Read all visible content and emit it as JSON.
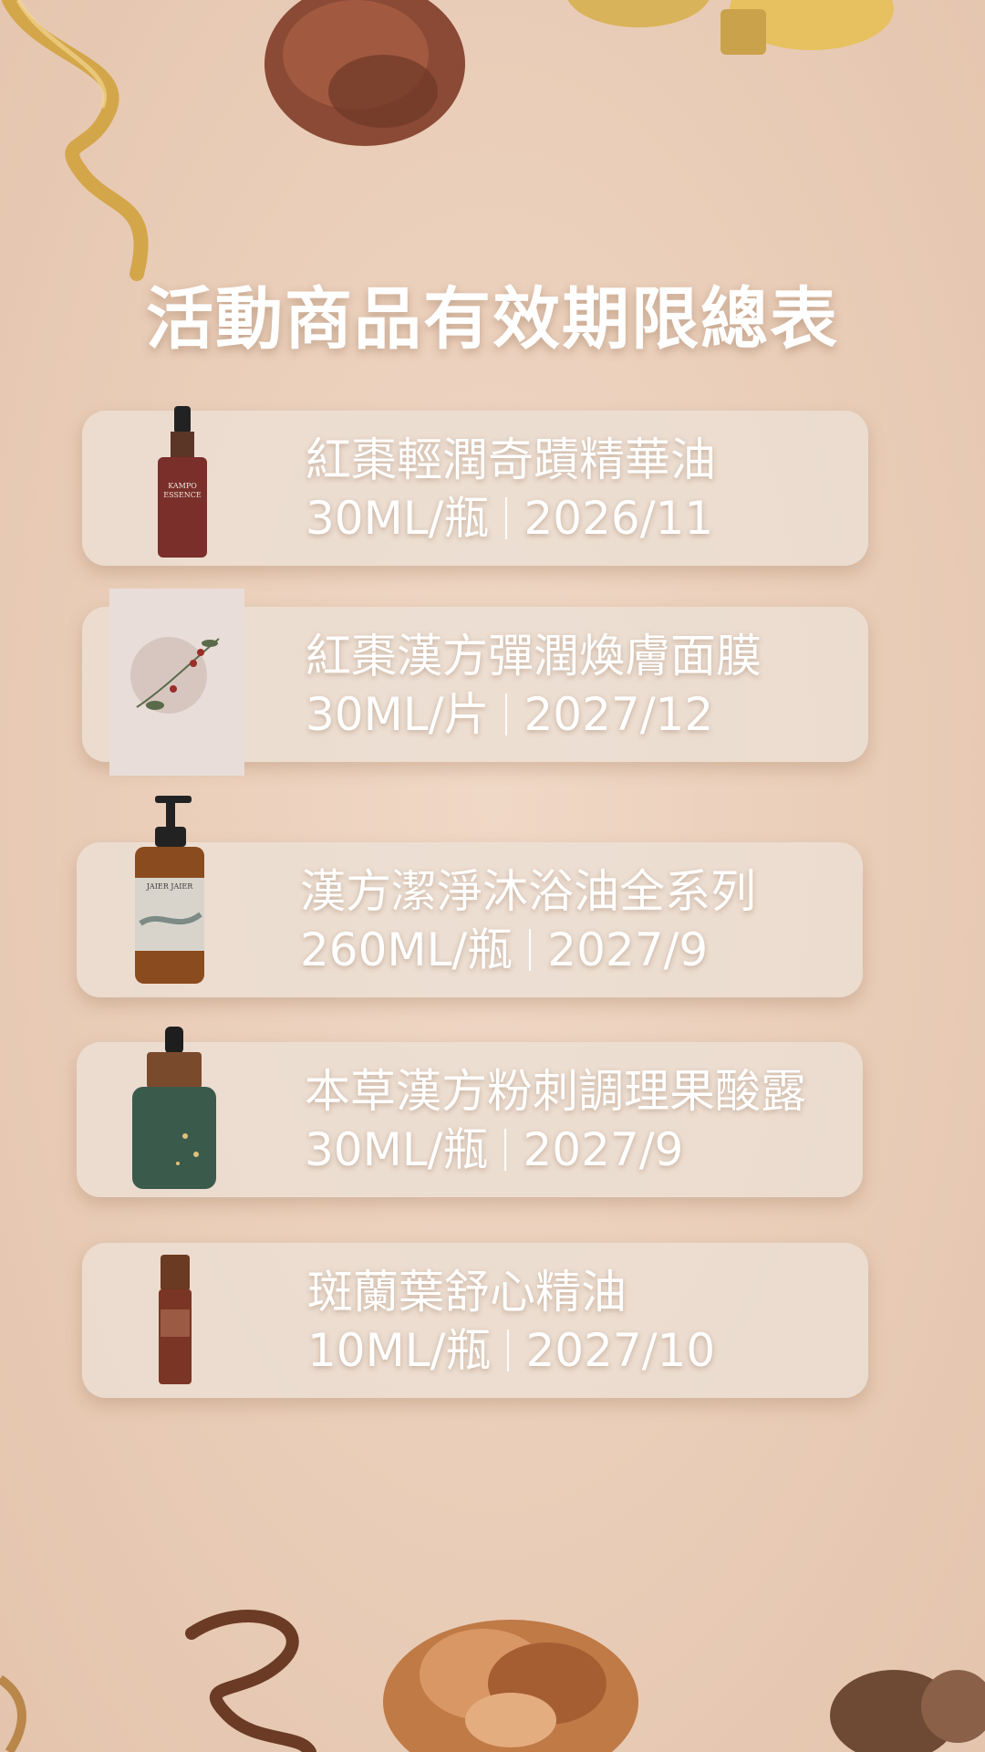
{
  "title": "活動商品有效期限總表",
  "products": [
    {
      "name": "紅棗輕潤奇蹟精華油",
      "spec": "30ML/瓶",
      "expiry": "2026/11"
    },
    {
      "name": "紅棗漢方彈潤煥膚面膜",
      "spec": "30ML/片",
      "expiry": "2027/12"
    },
    {
      "name": "漢方潔淨沐浴油全系列",
      "spec": "260ML/瓶",
      "expiry": "2027/9"
    },
    {
      "name": "本草漢方粉刺調理果酸露",
      "spec": "30ML/瓶",
      "expiry": "2027/9"
    },
    {
      "name": "斑蘭葉舒心精油",
      "spec": "10ML/瓶",
      "expiry": "2027/10"
    }
  ],
  "product_labels": {
    "essence_oil": "KAMPO ESSENCE",
    "body_oil": "JAIER JAIER"
  },
  "colors": {
    "background": "#ecd0bb",
    "card": "#ece0d6",
    "text": "#ffffff",
    "gold": "#d4a64a",
    "copper": "#b5683a"
  }
}
